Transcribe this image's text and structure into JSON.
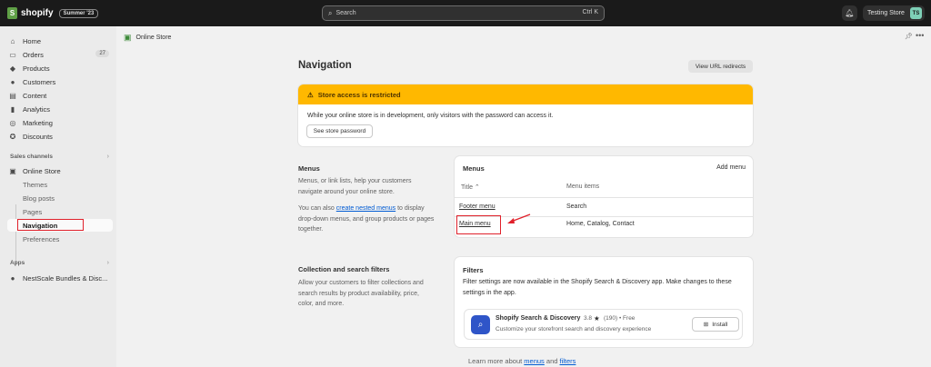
{
  "topbar": {
    "brand": "shopify",
    "edition": "Summer '23",
    "search_placeholder": "Search",
    "search_shortcut": "Ctrl K",
    "store_name": "Testing Store",
    "store_initials": "TS"
  },
  "sidebar": {
    "items": [
      {
        "label": "Home",
        "icon": "home-icon"
      },
      {
        "label": "Orders",
        "icon": "inbox-icon",
        "count": "27"
      },
      {
        "label": "Products",
        "icon": "tag-icon"
      },
      {
        "label": "Customers",
        "icon": "person-icon"
      },
      {
        "label": "Content",
        "icon": "content-icon"
      },
      {
        "label": "Analytics",
        "icon": "bar-chart-icon"
      },
      {
        "label": "Marketing",
        "icon": "target-icon"
      },
      {
        "label": "Discounts",
        "icon": "discount-icon"
      }
    ],
    "sales_channels_label": "Sales channels",
    "online_store": "Online Store",
    "subitems": [
      "Themes",
      "Blog posts",
      "Pages",
      "Navigation",
      "Preferences"
    ],
    "apps_label": "Apps",
    "app_item": "NestScale Bundles & Disc..."
  },
  "breadcrumb": {
    "label": "Online Store"
  },
  "page": {
    "title": "Navigation",
    "view_redirects": "View URL redirects"
  },
  "banner": {
    "title": "Store access is restricted",
    "body": "While your online store is in development, only visitors with the password can access it.",
    "button": "See store password"
  },
  "menus_section": {
    "title": "Menus",
    "desc1": "Menus, or link lists, help your customers navigate around your online store.",
    "desc2_pre": "You can also ",
    "desc2_link": "create nested menus",
    "desc2_post": " to display drop-down menus, and group products or pages together.",
    "card_title": "Menus",
    "add_menu": "Add menu",
    "col_title": "Title",
    "col_items": "Menu items",
    "rows": [
      {
        "title": "Footer menu",
        "items": "Search"
      },
      {
        "title": "Main menu",
        "items": "Home, Catalog, Contact"
      }
    ]
  },
  "filters_section": {
    "title": "Collection and search filters",
    "desc": "Allow your customers to filter collections and search results by product availability, price, color, and more.",
    "card_title": "Filters",
    "card_body": "Filter settings are now available in the Shopify Search & Discovery app. Make changes to these settings in the app.",
    "app_name": "Shopify Search & Discovery",
    "rating": "3.8",
    "reviews": "(190) • Free",
    "app_desc": "Customize your storefront search and discovery experience",
    "install": "Install"
  },
  "footer": {
    "pre": "Learn more about ",
    "link1": "menus",
    "mid": " and ",
    "link2": "filters"
  }
}
